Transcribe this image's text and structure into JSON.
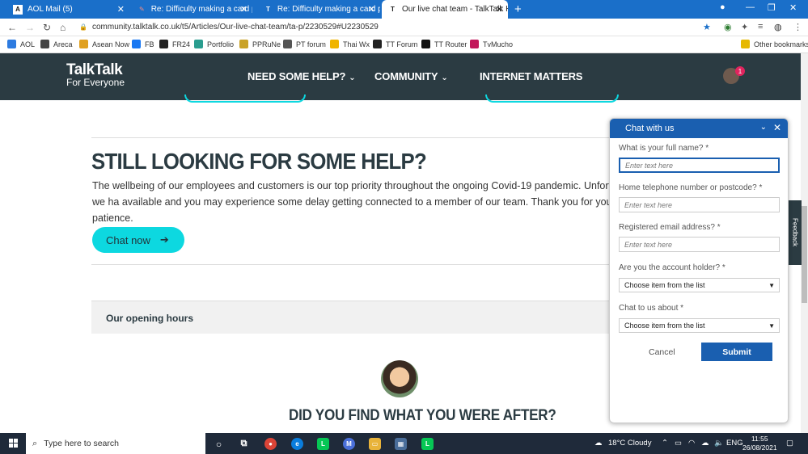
{
  "browser": {
    "tabs": [
      {
        "label": "AOL Mail (5)",
        "icon": "aol-icon"
      },
      {
        "label": "Re: Difficulty making a card pay",
        "icon": "community-icon"
      },
      {
        "label": "Re: Difficulty making a card pay",
        "icon": "talktalk-icon"
      },
      {
        "label": "Our live chat team - TalkTalk Hel",
        "icon": "talktalk-icon"
      }
    ],
    "url": "community.talktalk.co.uk/t5/Articles/Our-live-chat-team/ta-p/2230529#U2230529",
    "bookmarks": [
      {
        "label": "AOL",
        "color": "#2d7be0"
      },
      {
        "label": "Areca",
        "color": "#444"
      },
      {
        "label": "Asean Now",
        "color": "#e0a020"
      },
      {
        "label": "FB",
        "color": "#1877f2"
      },
      {
        "label": "FR24",
        "color": "#222"
      },
      {
        "label": "Portfolio",
        "color": "#2a9d8f"
      },
      {
        "label": "PPRuNe",
        "color": "#c9a227"
      },
      {
        "label": "PT forum",
        "color": "#555"
      },
      {
        "label": "Thai Wx",
        "color": "#f0b400"
      },
      {
        "label": "TT Forum",
        "color": "#222"
      },
      {
        "label": "TT Router",
        "color": "#111"
      },
      {
        "label": "TvMucho",
        "color": "#c2185b"
      }
    ],
    "other_bookmarks": "Other bookmarks"
  },
  "site": {
    "logo_line1": "TalkTalk",
    "logo_line2": "For Everyone",
    "nav": [
      "NEED SOME HELP?",
      "COMMUNITY",
      "INTERNET MATTERS"
    ],
    "notification_count": "1"
  },
  "page": {
    "heading": "STILL LOOKING FOR SOME HELP?",
    "paragraph": "The wellbeing of our employees and customers is our top priority throughout the ongoing Covid-19 pandemic. Unfortunately, we ha available and you may experience some delay getting connected to a member of our team. Thank you for your patience.",
    "chat_now": "Chat now",
    "opening_hours": "Our opening hours",
    "did_you_find": "DID YOU FIND WHAT YOU WERE AFTER?",
    "feedback": "Feedback"
  },
  "chat": {
    "title": "Chat with us",
    "fields": [
      {
        "label": "What is your full name? *",
        "placeholder": "Enter text here"
      },
      {
        "label": "Home telephone number or postcode? *",
        "placeholder": "Enter text here"
      },
      {
        "label": "Registered email address? *",
        "placeholder": "Enter text here"
      }
    ],
    "selects": [
      {
        "label": "Are you the account holder? *",
        "value": "Choose item from the list"
      },
      {
        "label": "Chat to us about *",
        "value": "Choose item from the list"
      }
    ],
    "cancel": "Cancel",
    "submit": "Submit"
  },
  "taskbar": {
    "search_placeholder": "Type here to search",
    "weather": "18°C  Cloudy",
    "lang": "ENG",
    "time": "11:55",
    "date": "26/08/2021"
  },
  "colors": {
    "brand_dark": "#2b3b42",
    "accent_cyan": "#0dd8e0",
    "chat_blue": "#1a5fb0",
    "browser_blue": "#1a6fc9"
  }
}
